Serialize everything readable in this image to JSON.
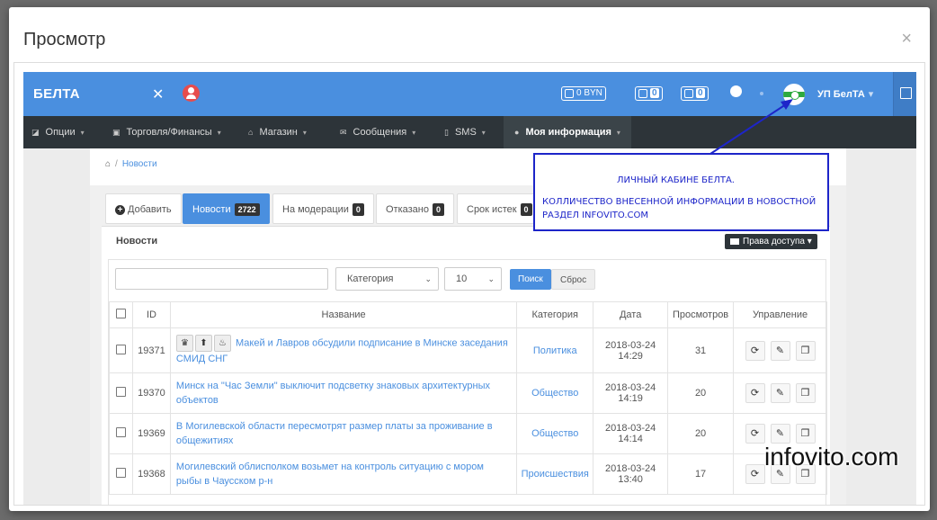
{
  "modal": {
    "title": "Просмотр",
    "close": "×"
  },
  "topbar": {
    "brand": "БЕЛТА",
    "wallet": "0 BYN",
    "messages_count": "0",
    "cart_count": "0",
    "user_name": "УП БелТА",
    "user_caret": "▾"
  },
  "nav": [
    {
      "icon": "◪",
      "label": "Опции",
      "caret": "▾"
    },
    {
      "icon": "▣",
      "label": "Торговля/Финансы",
      "caret": "▾"
    },
    {
      "icon": "⌂",
      "label": "Магазин",
      "caret": "▾"
    },
    {
      "icon": "✉",
      "label": "Сообщения",
      "caret": "▾"
    },
    {
      "icon": "▯",
      "label": "SMS",
      "caret": "▾"
    },
    {
      "icon": "●",
      "label": "Моя информация",
      "caret": "▾"
    }
  ],
  "breadcrumb": {
    "home": "⌂",
    "sep": "/",
    "current": "Новости"
  },
  "tabs": {
    "add": "Добавить",
    "news": {
      "label": "Новости",
      "count": "2722"
    },
    "moderation": {
      "label": "На модерации",
      "count": "0"
    },
    "rejected": {
      "label": "Отказано",
      "count": "0"
    },
    "expired": {
      "label": "Срок истек",
      "count": "0"
    }
  },
  "section": {
    "title": "Новости",
    "access_button": "Права доступа",
    "access_caret": "▾"
  },
  "filter": {
    "search_value": "",
    "category": "Категория",
    "per_page": "10",
    "search_button": "Поиск",
    "reset_button": "Сброс",
    "select_caret": "⌄"
  },
  "table": {
    "headers": {
      "id": "ID",
      "name": "Название",
      "category": "Категория",
      "date": "Дата",
      "views": "Просмотров",
      "mgmt": "Управление"
    },
    "rows": [
      {
        "id": "19371",
        "title": "Макей и Лавров обсудили подписание в Минске заседания СМИД СНГ",
        "category": "Политика",
        "date": "2018-03-24",
        "time": "14:29",
        "views": "31"
      },
      {
        "id": "19370",
        "title": "Минск на \"Час Земли\" выключит подсветку знаковых архитектурных объектов",
        "category": "Общество",
        "date": "2018-03-24",
        "time": "14:19",
        "views": "20"
      },
      {
        "id": "19369",
        "title": "В Могилевской области пересмотрят размер платы за проживание в общежитиях",
        "category": "Общество",
        "date": "2018-03-24",
        "time": "14:14",
        "views": "20"
      },
      {
        "id": "19368",
        "title": "Могилевский облисполком возьмет на контроль ситуацию с мором рыбы в Чаусском р-н",
        "category": "Происшествия",
        "date": "2018-03-24",
        "time": "13:40",
        "views": "17"
      }
    ]
  },
  "annotation": {
    "line1": "ЛИЧНЫЙ КАБИНЕ БЕЛТА.",
    "line2": "КОЛЛИЧЕСТВО ВНЕСЕННОЙ ИНФОРМАЦИИ В НОВОСТНОЙ",
    "line3": "РАЗДЕЛ  INFOVITO.COM"
  },
  "watermark": "infovito.com",
  "colors": {
    "accent": "#4a8fdf",
    "navbar": "#2d3439",
    "annotation": "#1d25c9"
  }
}
